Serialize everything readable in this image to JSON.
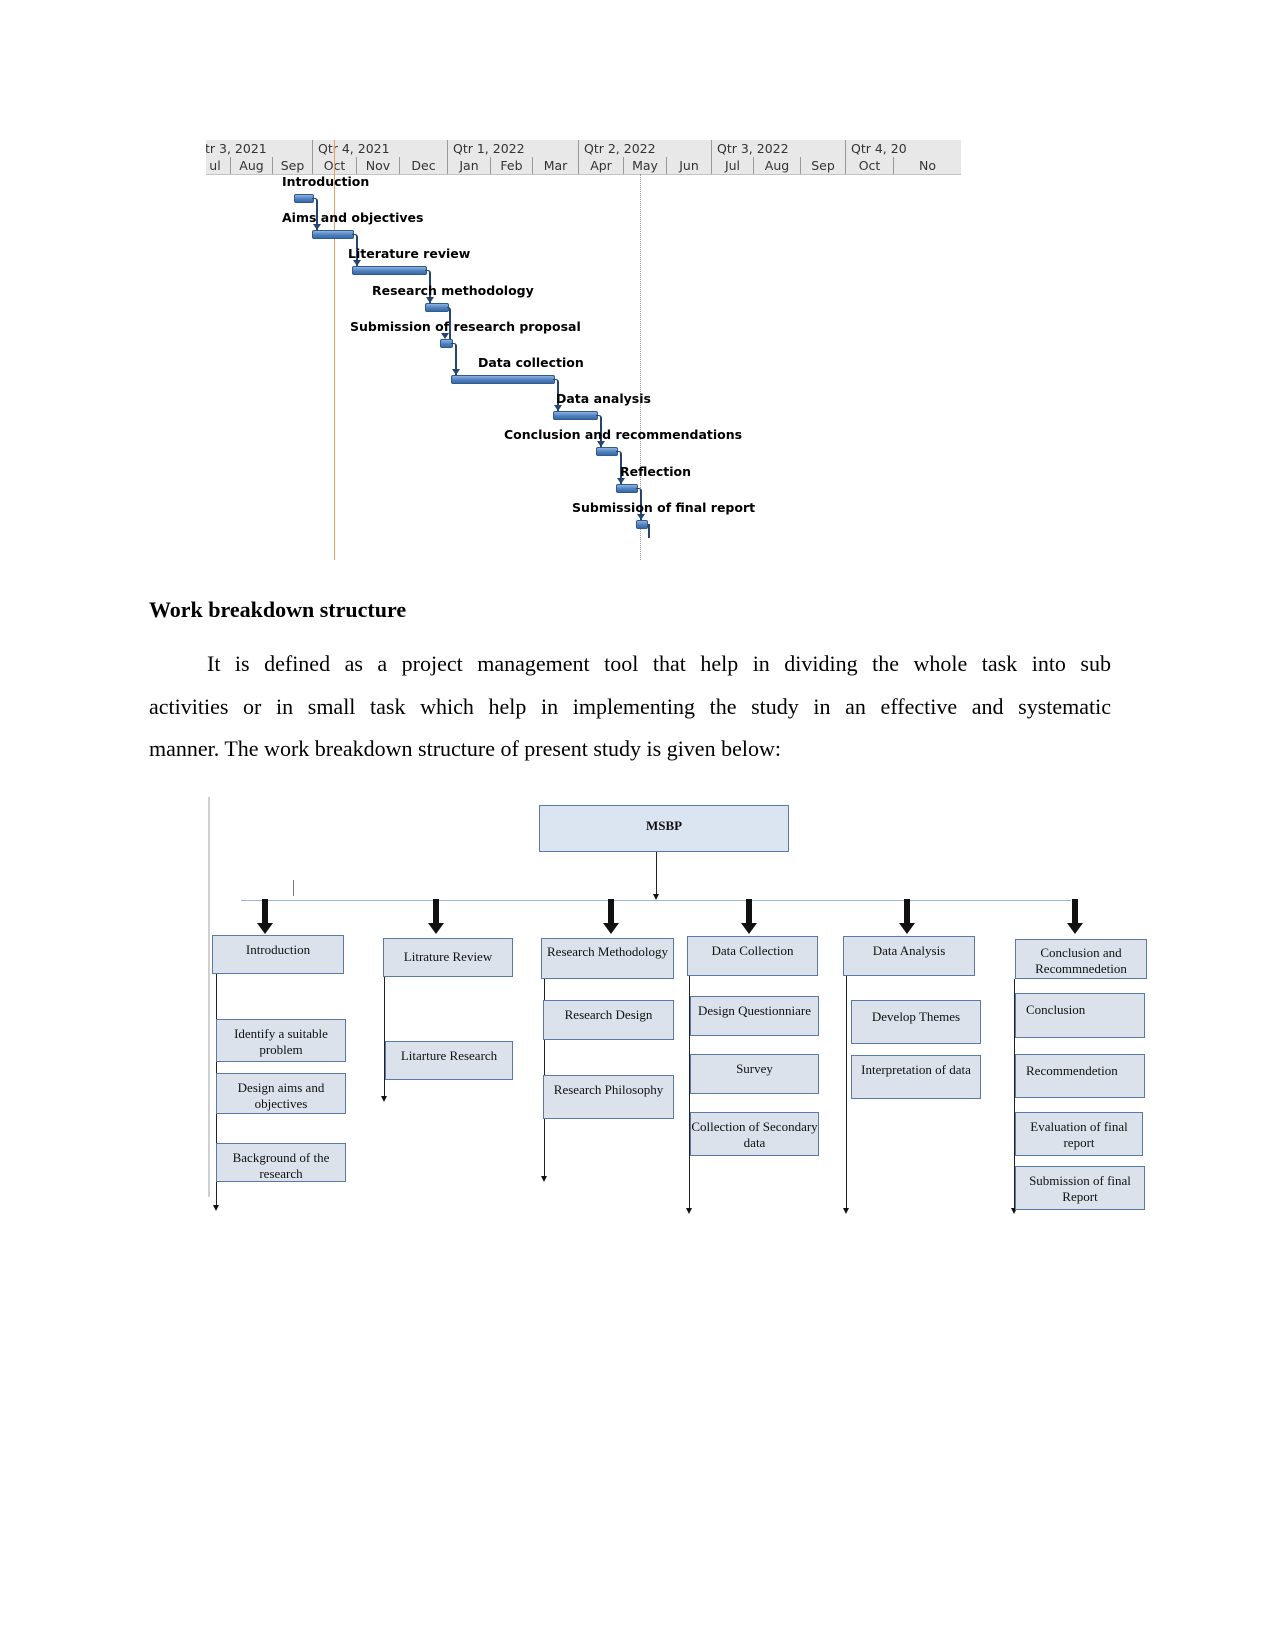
{
  "gantt": {
    "quarters": [
      "tr 3, 2021",
      "Qtr 4, 2021",
      "Qtr 1, 2022",
      "Qtr 2, 2022",
      "Qtr 3, 2022",
      "Qtr 4, 20"
    ],
    "months": [
      "ul",
      "Aug",
      "Sep",
      "Oct",
      "Nov",
      "Dec",
      "Jan",
      "Feb",
      "Mar",
      "Apr",
      "May",
      "Jun",
      "Jul",
      "Aug",
      "Sep",
      "Oct",
      "No"
    ],
    "tasks": [
      {
        "name": "Introduction",
        "start_month": 2.55,
        "end_month": 3.0
      },
      {
        "name": "Aims and objectives",
        "start_month": 3.0,
        "end_month": 3.9
      },
      {
        "name": "Literature review",
        "start_month": 3.9,
        "end_month": 5.55
      },
      {
        "name": "Research methodology",
        "start_month": 5.55,
        "end_month": 6.0
      },
      {
        "name": "Submission of research proposal",
        "start_month": 5.85,
        "end_month": 6.1
      },
      {
        "name": "Data collection",
        "start_month": 6.1,
        "end_month": 8.45
      },
      {
        "name": "Data analysis",
        "start_month": 8.45,
        "end_month": 9.4
      },
      {
        "name": "Conclusion and recommendations",
        "start_month": 9.4,
        "end_month": 9.85
      },
      {
        "name": "Reflection",
        "start_month": 9.85,
        "end_month": 10.3
      },
      {
        "name": "Submission of final report",
        "start_month": 10.3,
        "end_month": 10.35
      }
    ],
    "today_line_month": 3.5,
    "status_line_month": 10.4,
    "colors": {
      "bar": "#4f81bd",
      "today_line": "#e8a060",
      "connector": "#24456f"
    }
  },
  "section": {
    "heading": "Work breakdown structure",
    "paragraph_lines": [
      "It is defined as a project management tool that help in dividing the whole task into sub",
      "activities or in small task which help in implementing the study in an effective and systematic",
      "manner. The work breakdown structure of present study is given below:"
    ]
  },
  "wbs": {
    "root": "MSBP",
    "branches": [
      {
        "title": "Introduction",
        "children": [
          "Identify a suitable problem",
          "Design aims and objectives",
          "Background of the research"
        ]
      },
      {
        "title": "Litrature Review",
        "children": [
          "Litarture Research"
        ]
      },
      {
        "title": "Research Methodology",
        "children": [
          "Research Design",
          "Research Philosophy"
        ]
      },
      {
        "title": "Data Collection",
        "children": [
          "Design Questionniare",
          "Survey",
          "Collection of Secondary data"
        ]
      },
      {
        "title": "Data Analysis",
        "children": [
          "Develop Themes",
          "Interpretation of data"
        ]
      },
      {
        "title": "Conclusion and Recommnedetion",
        "children": [
          "Conclusion",
          "Recommendetion",
          "Evaluation of final report",
          "Submission of final Report"
        ]
      }
    ]
  }
}
